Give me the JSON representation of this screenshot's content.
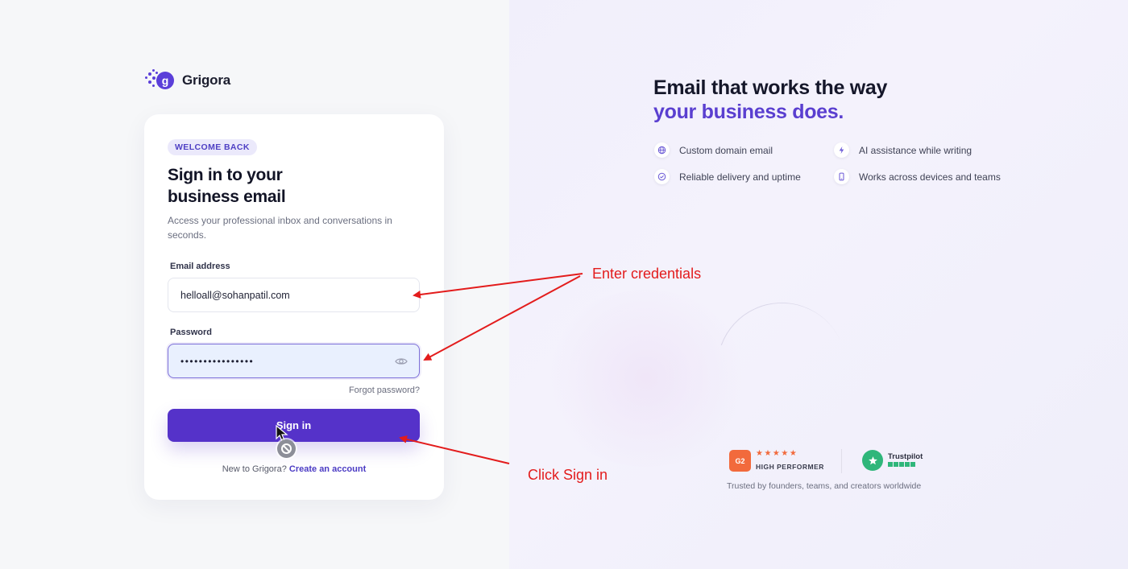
{
  "brand": {
    "name": "Grigora",
    "accent": "#5532c9"
  },
  "login": {
    "badge": "WELCOME BACK",
    "title_line1": "Sign in to your",
    "title_line2": "business email",
    "subtitle": "Access your professional inbox and conversations in seconds.",
    "email_label": "Email address",
    "email_value": "helloall@sohanpatil.com",
    "password_label": "Password",
    "password_value": "••••••••••••••••",
    "forgot_link": "Forgot password?",
    "signin_label": "Sign in",
    "new_prompt": "New to Grigora?",
    "create_link": "Create an account"
  },
  "promo": {
    "headline_line1": "Email that works the way",
    "headline_line2": "your business does.",
    "features": [
      {
        "icon": "globe-icon",
        "label": "Custom domain email"
      },
      {
        "icon": "lightning-icon",
        "label": "AI assistance while writing"
      },
      {
        "icon": "check-circle-icon",
        "label": "Reliable delivery and uptime"
      },
      {
        "icon": "mobile-icon",
        "label": "Works across devices and teams"
      }
    ],
    "g2_badge": "G2",
    "g2_stars": "★★★★★",
    "g2_label": "HIGH PERFORMER",
    "trustpilot_label": "Trustpilot",
    "trusted_by": "Trusted by founders, teams, and creators worldwide"
  },
  "annotations": {
    "enter_credentials": "Enter credentials",
    "click_signin": "Click Sign in",
    "color": "#e31c1c"
  }
}
